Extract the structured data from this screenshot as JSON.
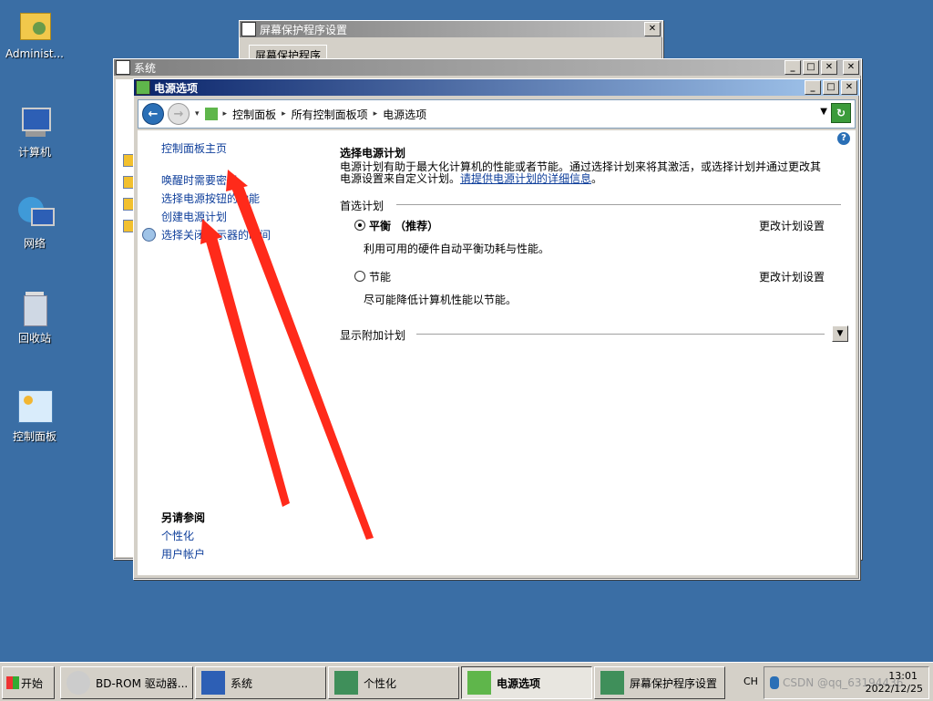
{
  "desktop": {
    "icons": [
      {
        "label": "Administ...",
        "icon": "folder-user-icon"
      },
      {
        "label": "计算机",
        "icon": "computer-icon"
      },
      {
        "label": "网络",
        "icon": "network-icon"
      },
      {
        "label": "回收站",
        "icon": "recycle-bin-icon"
      },
      {
        "label": "控制面板",
        "icon": "control-panel-icon"
      }
    ]
  },
  "windows": {
    "screensaver": {
      "title": "屏幕保护程序设置",
      "tab": "屏幕保护程序"
    },
    "system": {
      "title": "系统"
    },
    "power": {
      "title": "电源选项"
    }
  },
  "address": {
    "crumbs": [
      "控制面板",
      "所有控制面板项",
      "电源选项"
    ]
  },
  "sidebar": {
    "home": "控制面板主页",
    "links": [
      "唤醒时需要密码",
      "选择电源按钮的功能",
      "创建电源计划",
      "选择关闭显示器的时间"
    ],
    "see_also_title": "另请参阅",
    "see_also": [
      "个性化",
      "用户帐户"
    ]
  },
  "main": {
    "title": "选择电源计划",
    "desc": "电源计划有助于最大化计算机的性能或者节能。通过选择计划来将其激活，或选择计划并通过更改其电源设置来自定义计划。",
    "desc_link": "请提供电源计划的详细信息",
    "preferred_header": "首选计划",
    "plans": [
      {
        "name": "平衡 （推荐）",
        "desc": "利用可用的硬件自动平衡功耗与性能。",
        "change": "更改计划设置",
        "selected": true
      },
      {
        "name": "节能",
        "desc": "尽可能降低计算机性能以节能。",
        "change": "更改计划设置",
        "selected": false
      }
    ],
    "additional": "显示附加计划"
  },
  "taskbar": {
    "start": "开始",
    "buttons": [
      "BD-ROM 驱动器...",
      "系统",
      "个性化",
      "电源选项",
      "屏幕保护程序设置"
    ],
    "lang": "CH",
    "time": "13:01",
    "date": "2022/12/25"
  },
  "watermark": "CSDN @qq_63194436",
  "colors": {
    "desktop": "#3a6ea5",
    "arrow": "#ff2a1a",
    "link": "#0f3f9b"
  }
}
